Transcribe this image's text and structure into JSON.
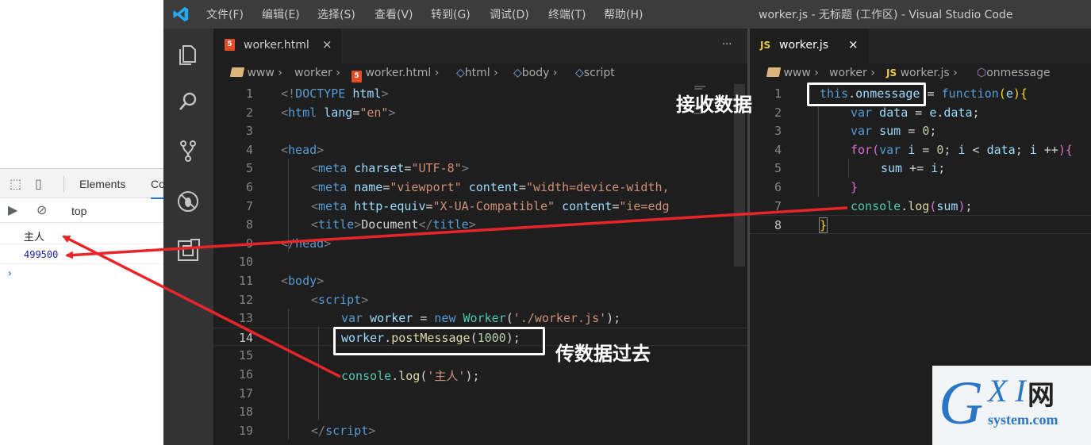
{
  "devtools": {
    "tabs": [
      "Elements",
      "Co"
    ],
    "context": "top",
    "console_lines": [
      {
        "type": "text",
        "value": "主人"
      },
      {
        "type": "number",
        "value": "499500"
      }
    ],
    "prompt": "›"
  },
  "vscode": {
    "menu": [
      "文件(F)",
      "编辑(E)",
      "选择(S)",
      "查看(V)",
      "转到(G)",
      "调试(D)",
      "终端(T)",
      "帮助(H)"
    ],
    "window_title": "worker.js - 无标题 (工作区) - Visual Studio Code",
    "left_editor": {
      "tab_label": "worker.html",
      "tab_close": "×",
      "more": "···",
      "breadcrumbs": [
        "www",
        "worker",
        "worker.html",
        "html",
        "body",
        "script"
      ],
      "line_numbers": [
        "1",
        "2",
        "3",
        "4",
        "5",
        "6",
        "7",
        "8",
        "9",
        "10",
        "11",
        "12",
        "13",
        "14",
        "15",
        "16",
        "17",
        "18",
        "19"
      ],
      "current_line": "14"
    },
    "right_editor": {
      "tab_label": "worker.js",
      "tab_close": "×",
      "breadcrumbs": [
        "www",
        "worker",
        "worker.js",
        "onmessage"
      ],
      "line_numbers": [
        "1",
        "2",
        "3",
        "4",
        "5",
        "6",
        "7",
        "8"
      ],
      "current_line": "8"
    }
  },
  "annotations": {
    "receive": "接收数据",
    "send": "传数据过去"
  },
  "watermark": {
    "g": "G",
    "xi": "X I",
    "cn": "网",
    "sub": "system.com"
  }
}
